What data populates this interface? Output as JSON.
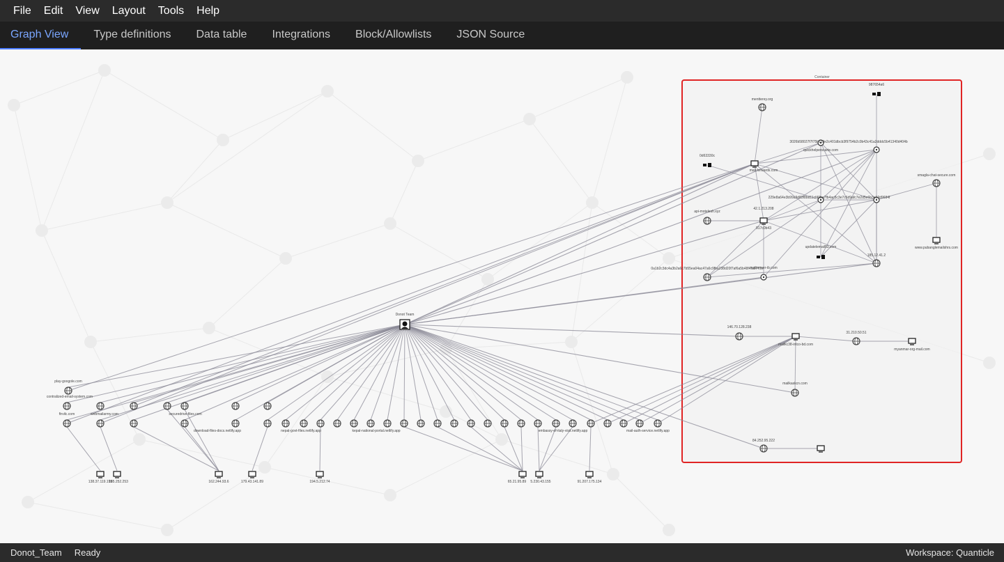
{
  "menu": [
    "File",
    "Edit",
    "View",
    "Layout",
    "Tools",
    "Help"
  ],
  "tabs": [
    "Graph View",
    "Type definitions",
    "Data table",
    "Integrations",
    "Block/Allowlists",
    "JSON Source"
  ],
  "active_tab": 0,
  "status": {
    "left": "Donot_Team",
    "state": "Ready",
    "workspace": "Workspace: Quanticle"
  },
  "colors": {
    "accent": "#4c7dff",
    "container_border": "#e02424",
    "edge": "#8a8896"
  },
  "graph": {
    "container_label": "Container",
    "center": {
      "label": "Donot Team",
      "icon": "hacker-group-icon"
    },
    "container_labels": [
      "mentterey.org",
      "987654a6",
      "3026b58027f7f75b1c3e2c401dbcb3f9754b2c0b43c41a2dddc5b41340d404b",
      "quickhelperscarte.com",
      "0d63330c",
      "mail.forwards.com",
      "smagla-chat-secure.com",
      "api-motelesh.xyz",
      "229e8a64e3b99a3d83f8bd11cf49ba7fb4ac5c3e7c6d9afc7e2d5e6b3e12d9684f",
      "42.1.213.208",
      "917c0b43",
      "updatelemail53.com",
      "185.12.41.2",
      "www.pubanglemailshrs.com",
      "0a1b2c3dc4a3b2a6c7b55ea04ac47a6c9fba238d20f7af6a5b48f4fa0772e",
      "mailserver-ib.com",
      "146.70.128.238",
      "mailkc38-intco-bd.com",
      "31.210.50.51",
      "myanmar-org-mail.com",
      "mailkaskcn.com",
      "84.252.95.222"
    ],
    "lower_labels": [
      "play-googole.com",
      "contralized-email-system.com",
      "ftrvilc.com",
      "webmailarmy.com",
      "securedrive-files.com",
      "download-files-docs.netlify.app",
      "nepal-govt-files.netlify.app",
      "kepal-national-portal.netlify.app",
      "embassy-of-italy-visit.netlify.app",
      "mail-auth-service.netlify.app",
      "138.37.119.199",
      "185.252.253",
      "162.244.93.6",
      "179.43.141.89",
      "194.5.212.74",
      "65.21.95.89",
      "5.230.43.155",
      "91.207.175.134"
    ]
  }
}
